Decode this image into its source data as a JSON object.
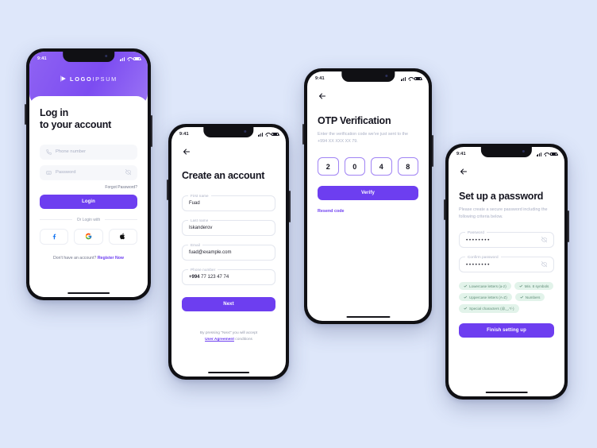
{
  "canvas": {
    "background": "#dee7fa",
    "accent": "#6d3ef0",
    "chip_bg": "#e2f3ea",
    "chip_text": "#5f8d77"
  },
  "status_bar": {
    "time": "9:41"
  },
  "login": {
    "logo_text": "LOGO",
    "logo_text_light": "IPSUM",
    "title_line1": "Log in",
    "title_line2": "to your account",
    "phone_placeholder": "Phone number",
    "password_placeholder": "Password",
    "forgot_label": "Forgot Password?",
    "login_button": "Login",
    "or_label": "Or Login with",
    "socials": [
      "facebook",
      "google",
      "apple"
    ],
    "register_prompt": "Don't have an account? ",
    "register_link": "Register Now"
  },
  "signup": {
    "title": "Create an account",
    "fields": [
      {
        "label": "First name",
        "value": "Fuad"
      },
      {
        "label": "Last name",
        "value": "Iskanderov"
      },
      {
        "label": "Email",
        "value": "fuad@example.com"
      }
    ],
    "phone_label": "Phone number",
    "phone_code": "+994",
    "phone_rest": " 77 123 47 74",
    "next_button": "Next",
    "agree_pre": "By pressing \"Next\" you will accept ",
    "agree_link": "User Agreement",
    "agree_post": " conditions"
  },
  "otp": {
    "title": "OTP Verification",
    "subtitle": "Enter the verification code we've just sent to the +994 XX XXX XX 79.",
    "digits": [
      "2",
      "0",
      "4",
      "8"
    ],
    "verify_button": "Verify",
    "resend_label": "Resend code"
  },
  "password": {
    "title": "Set up a password",
    "subtitle": "Please create a secure password including the following criteria below.",
    "password_label": "Password",
    "password_value": "••••••••",
    "confirm_label": "Confirm password",
    "confirm_value": "••••••••",
    "criteria": [
      "Lowercase letters (a-z)",
      "Min. 8 symbols",
      "Uppercase letters (A-Z)",
      "Numbers",
      "Special characters (@,_,*/-)"
    ],
    "finish_button": "Finish setting up"
  }
}
